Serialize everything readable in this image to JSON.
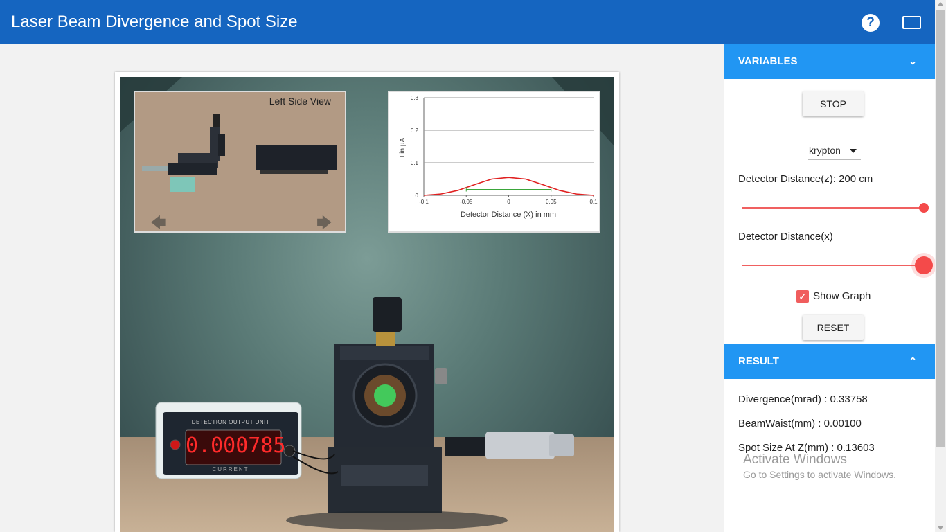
{
  "header": {
    "title": "Laser Beam Divergence and Spot Size",
    "help_icon": "question-circle-icon",
    "fullscreen_icon": "fullscreen-icon"
  },
  "simulation": {
    "left_view_title": "Left Side View",
    "readout": "0.000785",
    "unit_label": "DETECTION OUTPUT UNIT",
    "unit_sublabel": "CURRENT",
    "nav_prev_icon": "arrow-left-icon",
    "nav_next_icon": "arrow-right-icon"
  },
  "chart_data": {
    "type": "line",
    "title": "",
    "xlabel": "Detector Distance (X) in mm",
    "ylabel": "I in µA",
    "xlim": [
      -0.1,
      0.1
    ],
    "ylim": [
      0,
      0.3
    ],
    "x_ticks": [
      "-0.1",
      "-0.05",
      "0",
      "0.05",
      "0.1"
    ],
    "y_ticks": [
      "0",
      "0.1",
      "0.2",
      "0.3"
    ],
    "grid": true,
    "series": [
      {
        "color": "#e02020",
        "x": [
          -0.1,
          -0.08,
          -0.06,
          -0.04,
          -0.02,
          0,
          0.02,
          0.04,
          0.06,
          0.08,
          0.1
        ],
        "y": [
          0.0,
          0.004,
          0.015,
          0.033,
          0.05,
          0.055,
          0.05,
          0.033,
          0.015,
          0.004,
          0.0
        ]
      },
      {
        "color": "#3aa63a",
        "x": [
          -0.05,
          0.05
        ],
        "y": [
          0.018,
          0.018
        ]
      }
    ]
  },
  "variables": {
    "header": "VARIABLES",
    "stop_label": "STOP",
    "laser_selected": "krypton",
    "detector_z_label": "Detector Distance(z): 200 cm",
    "detector_z_level": 1.0,
    "detector_x_label": "Detector Distance(x)",
    "detector_x_level": 1.0,
    "show_graph_label": "Show Graph",
    "show_graph_checked": true,
    "reset_label": "RESET"
  },
  "result": {
    "header": "RESULT",
    "divergence": "Divergence(mrad) : 0.33758",
    "beam_waist": "BeamWaist(mm) : 0.00100",
    "spot_size": "Spot Size At Z(mm) : 0.13603"
  },
  "watermark": {
    "title": "Activate Windows",
    "subtitle": "Go to Settings to activate Windows."
  },
  "colors": {
    "header_bg": "#1565c0",
    "panel_head_bg": "#2196f3",
    "slider": "#f44a4a",
    "readout": "#ff2a2a"
  }
}
